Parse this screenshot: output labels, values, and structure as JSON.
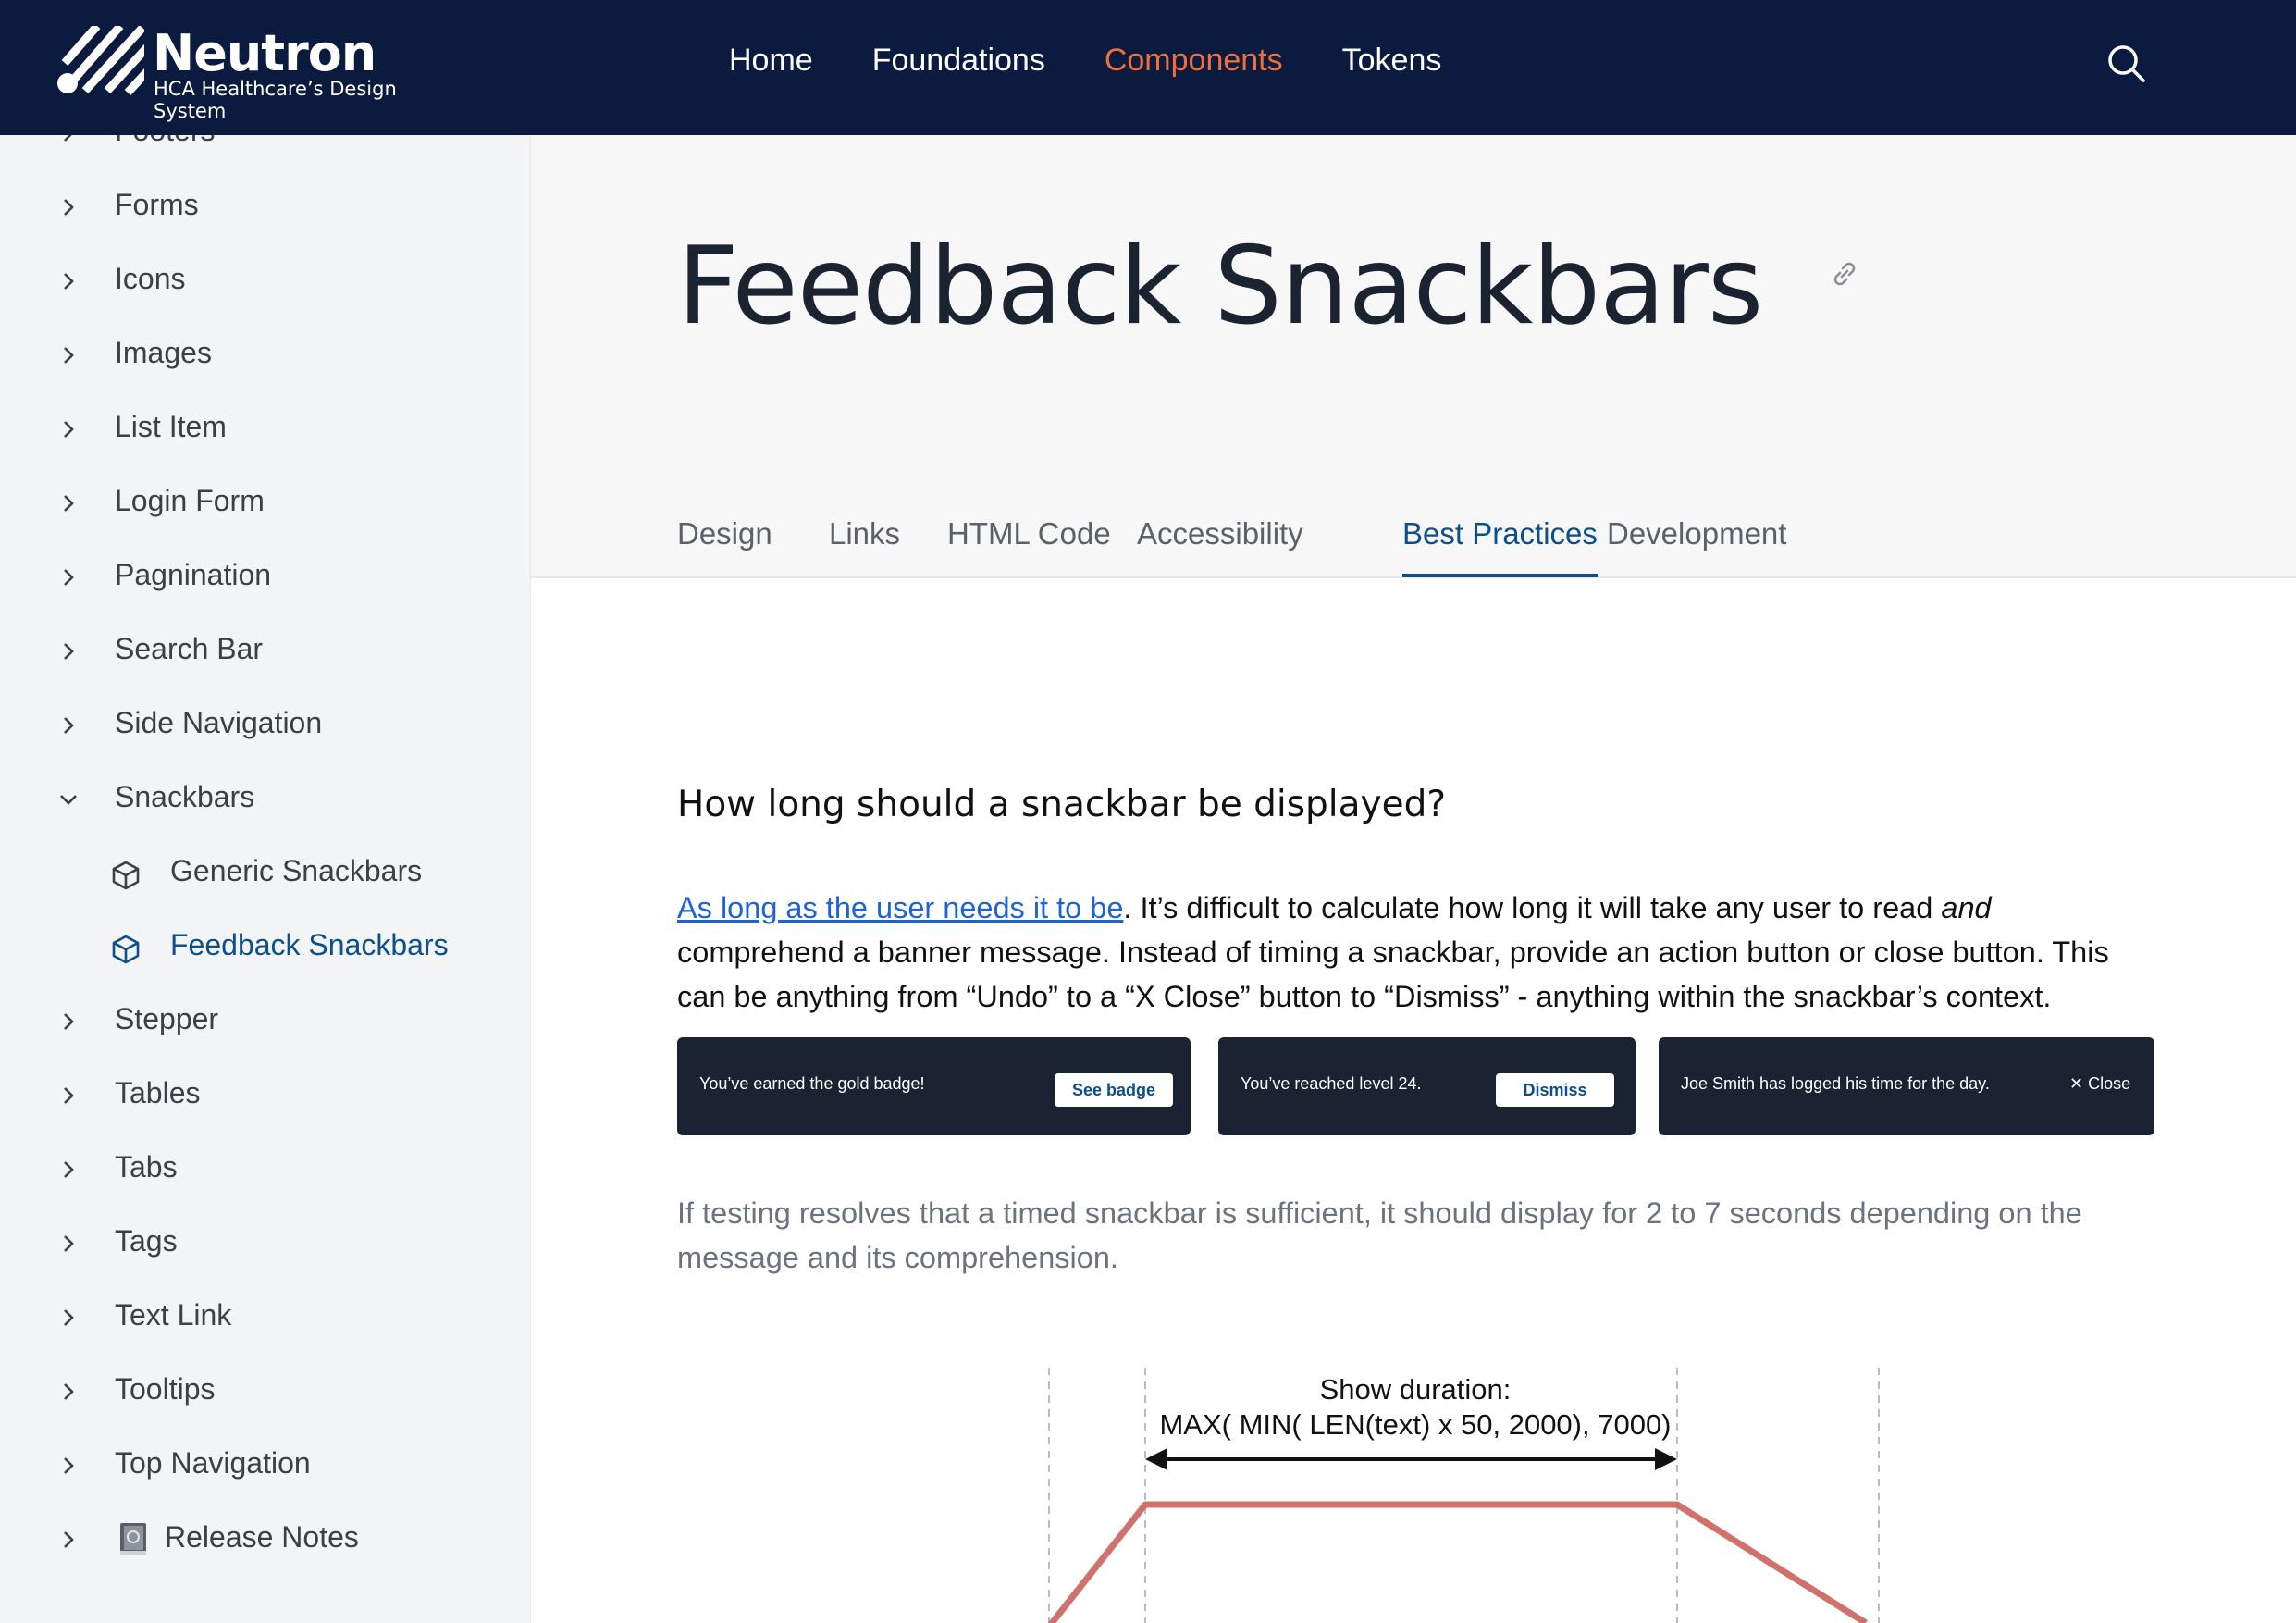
{
  "brand": {
    "name": "Neutron",
    "subtitle": "HCA Healthcare’s Design System"
  },
  "top_nav": {
    "items": [
      {
        "label": "Home",
        "active": false
      },
      {
        "label": "Foundations",
        "active": false
      },
      {
        "label": "Components",
        "active": true
      },
      {
        "label": "Tokens",
        "active": false
      }
    ]
  },
  "sidebar": {
    "partial_item": "Footers",
    "items": [
      {
        "label": "Forms"
      },
      {
        "label": "Icons"
      },
      {
        "label": "Images"
      },
      {
        "label": "List Item"
      },
      {
        "label": "Login Form"
      },
      {
        "label": "Pagnination"
      },
      {
        "label": "Search Bar"
      },
      {
        "label": "Side Navigation"
      },
      {
        "label": "Snackbars",
        "expanded": true
      },
      {
        "label": "Stepper"
      },
      {
        "label": "Tables"
      },
      {
        "label": "Tabs"
      },
      {
        "label": "Tags"
      },
      {
        "label": "Text Link"
      },
      {
        "label": "Tooltips"
      },
      {
        "label": "Top Navigation"
      },
      {
        "label": "Release Notes"
      }
    ],
    "sub_items": [
      {
        "label": "Generic Snackbars",
        "active": false
      },
      {
        "label": "Feedback Snackbars",
        "active": true
      }
    ]
  },
  "page": {
    "title": "Feedback Snackbars",
    "tabs": [
      {
        "label": "Design",
        "active": false
      },
      {
        "label": "Links",
        "active": false
      },
      {
        "label": "HTML Code",
        "active": false
      },
      {
        "label": "Accessibility",
        "active": false
      },
      {
        "label": "Best Practices",
        "active": true
      },
      {
        "label": "Development",
        "active": false
      }
    ]
  },
  "content": {
    "heading": "How long should a snackbar be displayed?",
    "para1_link": "As long as the user needs it to be",
    "para1_a": ". It’s difficult to calculate how long it will take any user to read ",
    "para1_em": "and",
    "para1_b": " comprehend a banner message. Instead of timing a snackbar, provide an action button or close button. This can be anything from “Undo” to a “X Close” button to “Dismiss” - anything within the snackbar’s context.",
    "snackbars": [
      {
        "text": "You’ve earned the gold badge!",
        "action": "See badge"
      },
      {
        "text": "You’ve reached level 24.",
        "action": "Dismiss"
      },
      {
        "text": "Joe Smith has logged his time for the day.",
        "action": "✕ Close"
      }
    ],
    "para2": "If testing resolves that a timed snackbar is sufficient, it should display for 2 to 7 seconds depending on the message and its comprehension.",
    "diagram": {
      "line1": "Show duration:",
      "line2": "MAX( MIN( LEN(text) x 50, 2000), 7000)"
    }
  },
  "colors": {
    "nav_bg": "#0b1a3f",
    "accent": "#ef6e3a",
    "active_blue": "#0c4f8a",
    "link": "#1d63d8",
    "snack_bg": "#1b2232",
    "curve": "#d0716b"
  },
  "icons": [
    "search-icon",
    "chevron-right-icon",
    "chevron-down-icon",
    "cube-icon",
    "link-icon",
    "book-icon"
  ]
}
